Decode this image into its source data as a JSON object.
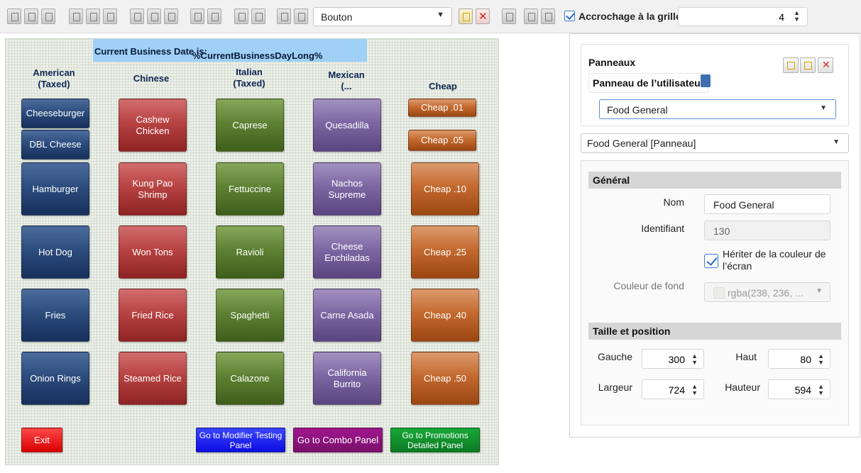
{
  "toolbar": {
    "type_select": "Bouton",
    "snap_label": "Accrochage à la grille",
    "snap_checked": true,
    "grid_size": "4"
  },
  "canvas": {
    "banner_label": "Current Business Date is:",
    "banner_value": "%CurrentBusinessDayLong%",
    "columns": [
      {
        "label": "American\n(Taxed)"
      },
      {
        "label": "Chinese"
      },
      {
        "label": "Italian\n(Taxed)"
      },
      {
        "label": "Mexican\n(..."
      },
      {
        "label": "Cheap"
      }
    ],
    "buttons": {
      "american": [
        "Cheeseburger",
        "DBL Cheese",
        "Hamburger",
        "Hot Dog",
        "Fries",
        "Onion Rings"
      ],
      "chinese": [
        "Cashew Chicken",
        "Kung Pao Shrimp",
        "Won Tons",
        "Fried Rice",
        "Steamed Rice"
      ],
      "italian": [
        "Caprese",
        "Fettuccine",
        "Ravioli",
        "Spaghetti",
        "Calazone"
      ],
      "mexican": [
        "Quesadilla",
        "Nachos Supreme",
        "Cheese Enchiladas",
        "Carne Asada",
        "California Burrito"
      ],
      "cheap": [
        "Cheap .01",
        "Cheap .05",
        "Cheap .10",
        "Cheap .25",
        "Cheap .40",
        "Cheap .50"
      ]
    },
    "bottom": {
      "exit": "Exit",
      "modifier": "Go to Modifier Testing Panel",
      "combo": "Go to Combo Panel",
      "promo": "Go to Promotions Detailed Panel"
    }
  },
  "panels": {
    "title": "Panneaux",
    "user_panel": "Panneau de l’utilisateur",
    "panel_select": "Food General",
    "object_select": "Food General [Panneau]"
  },
  "general": {
    "header": "Général",
    "name_label": "Nom",
    "name_value": "Food General",
    "id_label": "Identifiant",
    "id_value": "130",
    "inherit_label": "Hériter de la couleur de l’écran",
    "bg_label": "Couleur de fond",
    "bg_value": "rgba(238, 236, ..."
  },
  "size_position": {
    "header": "Taille et position",
    "left_label": "Gauche",
    "left_value": "300",
    "top_label": "Haut",
    "top_value": "80",
    "width_label": "Largeur",
    "width_value": "724",
    "height_label": "Hauteur",
    "height_value": "594"
  }
}
